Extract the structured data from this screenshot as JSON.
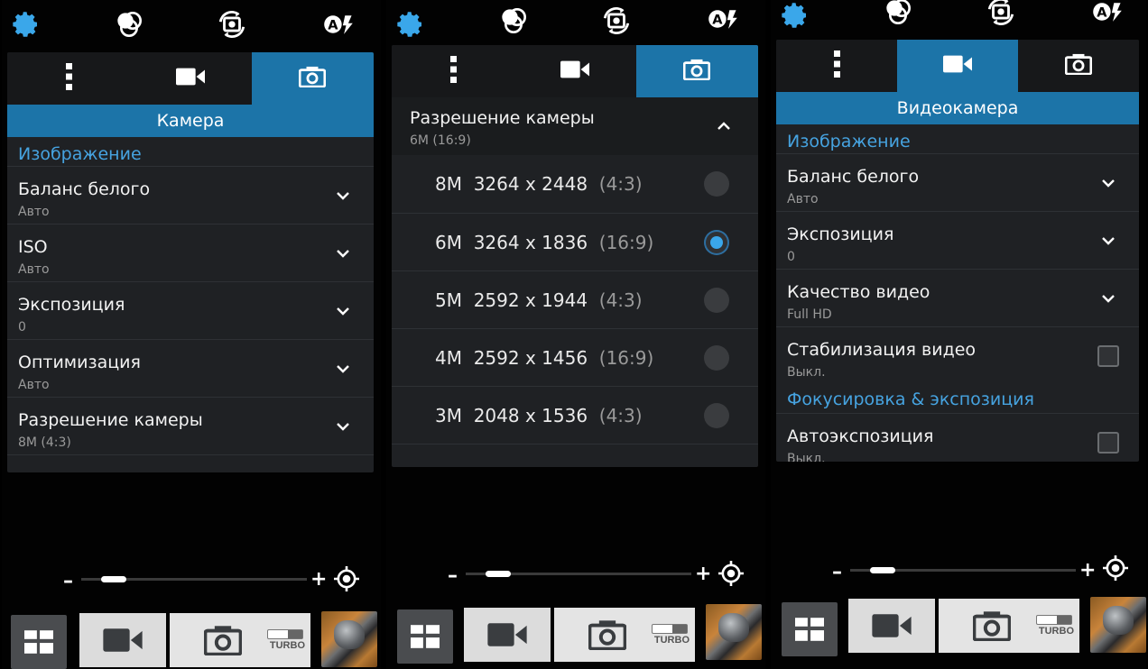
{
  "colors": {
    "accent": "#1c74a8",
    "section": "#46a3e0",
    "panel": "#1f2124"
  },
  "screens": [
    {
      "header": "Камера",
      "section": "Изображение",
      "rows": [
        {
          "title": "Баланс белого",
          "value": "Авто"
        },
        {
          "title": "ISO",
          "value": "Авто"
        },
        {
          "title": "Экспозиция",
          "value": "0"
        },
        {
          "title": "Оптимизация",
          "value": "Авто"
        },
        {
          "title": "Разрешение камеры",
          "value": "8M (4:3)"
        }
      ],
      "turbo": "TURBO",
      "zoom": {
        "minus": "–",
        "plus": "+",
        "level": 0.1
      }
    },
    {
      "expanded_title": "Разрешение камеры",
      "expanded_value": "6M (16:9)",
      "options": [
        {
          "mp": "8M",
          "res": "3264 x 2448",
          "ratio": "(4:3)",
          "selected": false
        },
        {
          "mp": "6M",
          "res": "3264 x 1836",
          "ratio": "(16:9)",
          "selected": true
        },
        {
          "mp": "5M",
          "res": "2592 x 1944",
          "ratio": "(4:3)",
          "selected": false
        },
        {
          "mp": "4M",
          "res": "2592 x 1456",
          "ratio": "(16:9)",
          "selected": false
        },
        {
          "mp": "3M",
          "res": "2048 x 1536",
          "ratio": "(4:3)",
          "selected": false
        }
      ],
      "turbo": "TURBO",
      "zoom": {
        "minus": "–",
        "plus": "+",
        "level": 0.1
      }
    },
    {
      "header": "Видеокамера",
      "section": "Изображение",
      "rows": [
        {
          "title": "Баланс белого",
          "value": "Авто"
        },
        {
          "title": "Экспозиция",
          "value": "0"
        },
        {
          "title": "Качество видео",
          "value": "Full HD"
        },
        {
          "title": "Стабилизация видео",
          "value": "Выкл."
        }
      ],
      "section2": "Фокусировка & экспозиция",
      "row_last": {
        "title": "Автоэкспозиция",
        "value": "Выкл."
      },
      "turbo": "TURBO",
      "zoom": {
        "minus": "–",
        "plus": "+",
        "level": 0.1
      }
    }
  ]
}
